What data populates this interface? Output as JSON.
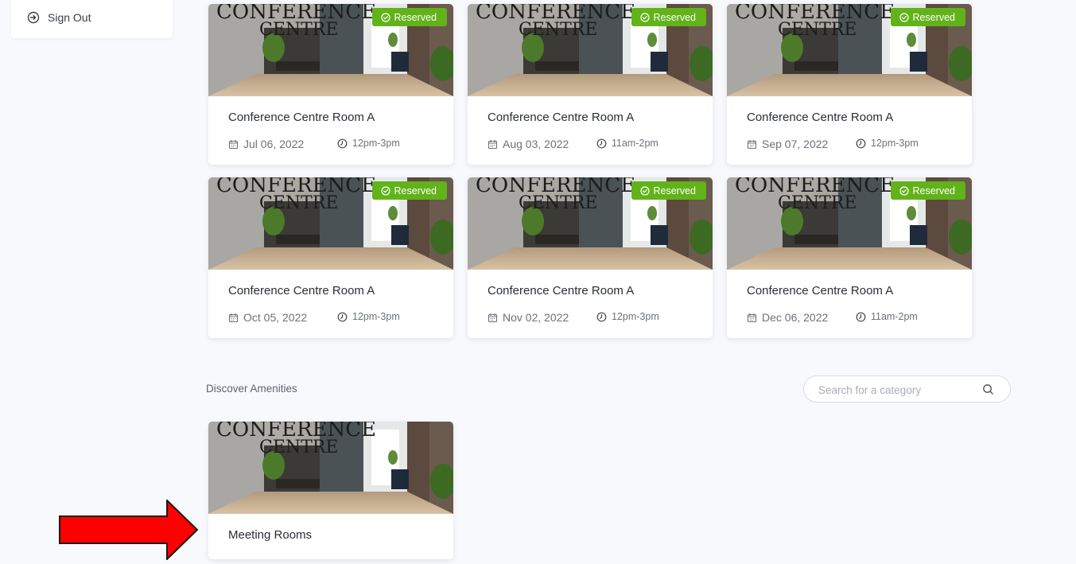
{
  "sidebar": {
    "sign_out_label": "Sign Out",
    "icon": "sign-out-icon"
  },
  "reservations": [
    {
      "title": "Conference Centre Room A",
      "badge": "Reserved",
      "date": "Jul 06, 2022",
      "time": "12pm-3pm"
    },
    {
      "title": "Conference Centre Room A",
      "badge": "Reserved",
      "date": "Aug 03, 2022",
      "time": "11am-2pm"
    },
    {
      "title": "Conference Centre Room A",
      "badge": "Reserved",
      "date": "Sep 07, 2022",
      "time": "12pm-3pm"
    },
    {
      "title": "Conference Centre Room A",
      "badge": "Reserved",
      "date": "Oct 05, 2022",
      "time": "12pm-3pm"
    },
    {
      "title": "Conference Centre Room A",
      "badge": "Reserved",
      "date": "Nov 02, 2022",
      "time": "12pm-3pm"
    },
    {
      "title": "Conference Centre Room A",
      "badge": "Reserved",
      "date": "Dec 06, 2022",
      "time": "11am-2pm"
    }
  ],
  "photo_sign_text": [
    "CONFERENCE",
    "CENTRE"
  ],
  "amenities": {
    "title": "Discover Amenities",
    "search_placeholder": "Search for a category",
    "items": [
      {
        "title": "Meeting Rooms"
      }
    ]
  },
  "colors": {
    "badge": "#62b21a",
    "background": "#f8f9fd",
    "annotation_arrow": "#ff0000"
  }
}
